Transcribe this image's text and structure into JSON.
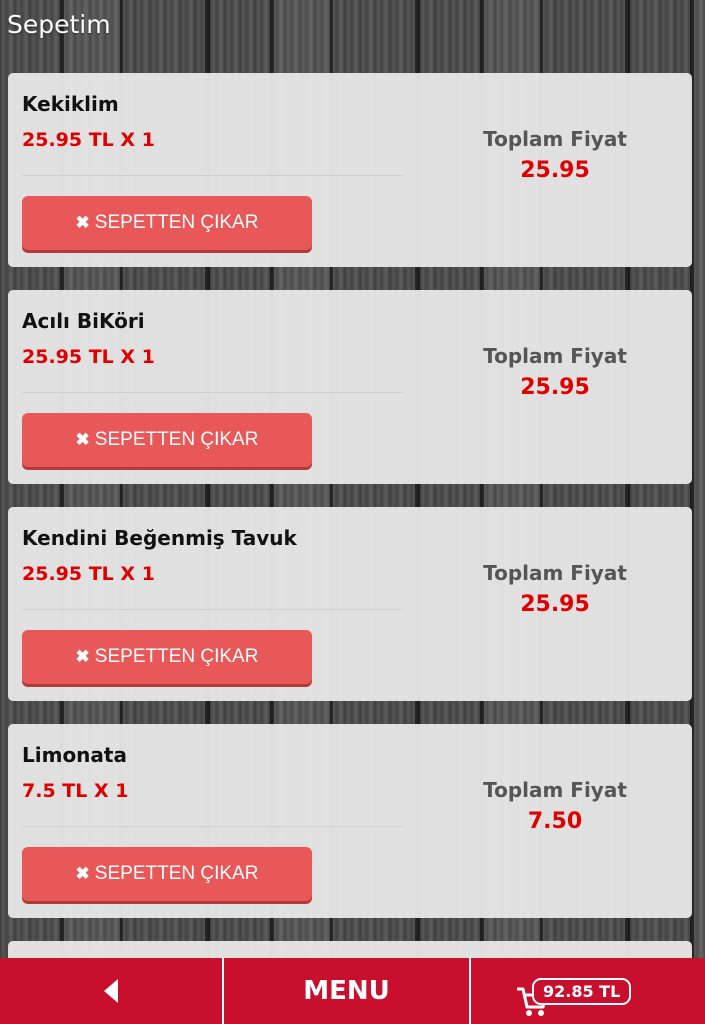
{
  "header": {
    "title": "Sepetim"
  },
  "cart_items": [
    {
      "name": "Kekiklim",
      "unit_line": "25.95 TL X 1",
      "total_label": "Toplam Fiyat",
      "total_value": "25.95",
      "remove_label": "SEPETTEN ÇIKAR"
    },
    {
      "name": "Acılı BiKöri",
      "unit_line": "25.95 TL X 1",
      "total_label": "Toplam Fiyat",
      "total_value": "25.95",
      "remove_label": "SEPETTEN ÇIKAR"
    },
    {
      "name": "Kendini Beğenmiş Tavuk",
      "unit_line": "25.95 TL X 1",
      "total_label": "Toplam Fiyat",
      "total_value": "25.95",
      "remove_label": "SEPETTEN ÇIKAR"
    },
    {
      "name": "Limonata",
      "unit_line": "7.5 TL X 1",
      "total_label": "Toplam Fiyat",
      "total_value": "7.50",
      "remove_label": "SEPETTEN ÇIKAR"
    }
  ],
  "bottom_bar": {
    "back_icon": "chevron-left-icon",
    "menu_label": "MENU",
    "cart_icon": "shopping-cart-icon",
    "cart_total": "92.85 TL"
  },
  "colors": {
    "accent": "#c8102e",
    "button": "#e85858",
    "price": "#e00000"
  }
}
